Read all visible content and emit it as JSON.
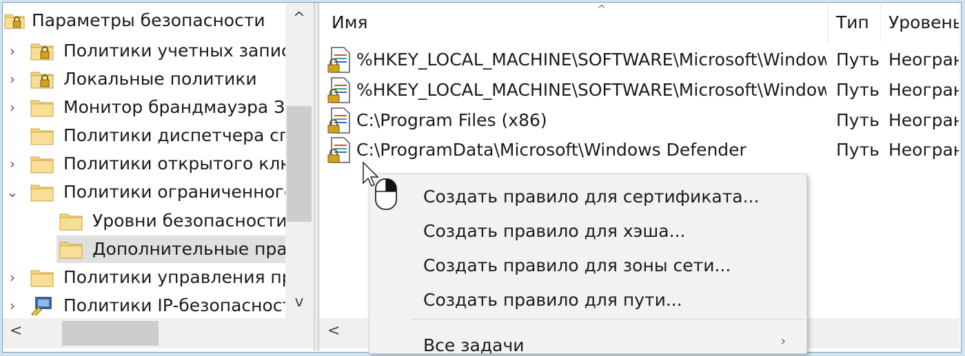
{
  "tree": {
    "root_label": "Параметры безопасности",
    "items": [
      {
        "expander": "›",
        "label": "Политики учетных записей",
        "icon": "lock-folder-icon"
      },
      {
        "expander": "›",
        "label": "Локальные политики",
        "icon": "lock-folder-icon"
      },
      {
        "expander": "›",
        "label": "Монитор брандмауэра Защитника Windows",
        "icon": "folder-icon"
      },
      {
        "expander": "",
        "label": "Политики диспетчера списка сетей",
        "icon": "folder-icon"
      },
      {
        "expander": "›",
        "label": "Политики открытого ключа",
        "icon": "folder-icon"
      },
      {
        "expander": "⌄",
        "label": "Политики ограниченного использования программ",
        "icon": "folder-icon"
      },
      {
        "expander": "",
        "label": "Уровни безопасности",
        "icon": "folder-icon"
      },
      {
        "expander": "",
        "label": "Дополнительные правила",
        "icon": "folder-icon"
      },
      {
        "expander": "›",
        "label": "Политики управления приложениями",
        "icon": "folder-icon"
      },
      {
        "expander": "›",
        "label": "Политики IP-безопасности на \"Локальный компьютер\"",
        "icon": "network-security-icon"
      }
    ],
    "vscroll_up": "^",
    "vscroll_down": "v",
    "hscroll_left": "<"
  },
  "list": {
    "columns": [
      "Имя",
      "Тип",
      "Уровень безопасности"
    ],
    "sort_indicator": "^",
    "rows": [
      {
        "name": "%HKEY_LOCAL_MACHINE\\SOFTWARE\\Microsoft\\Windows NT\\CurrentVersion\\SystemRoot%",
        "type": "Путь",
        "level": "Неограниченный"
      },
      {
        "name": "%HKEY_LOCAL_MACHINE\\SOFTWARE\\Microsoft\\Windows\\CurrentVersion\\ProgramFilesDir%",
        "type": "Путь",
        "level": "Неограниченный"
      },
      {
        "name": "C:\\Program Files (x86)",
        "type": "Путь",
        "level": "Неограниченный"
      },
      {
        "name": "C:\\ProgramData\\Microsoft\\Windows Defender",
        "type": "Путь",
        "level": "Неограниченный"
      }
    ],
    "hscroll_left": "<"
  },
  "context_menu": {
    "items": [
      "Создать правило для сертификата...",
      "Создать правило для хэша...",
      "Создать правило для зоны сети...",
      "Создать правило для пути..."
    ],
    "all_tasks": "Все задачи",
    "submenu_arrow": "›"
  },
  "colors": {
    "selection": "#e0e0e0",
    "folder": "#f5d37a",
    "lock": "#d4a21a",
    "menu_background": "#f2f2f2"
  }
}
